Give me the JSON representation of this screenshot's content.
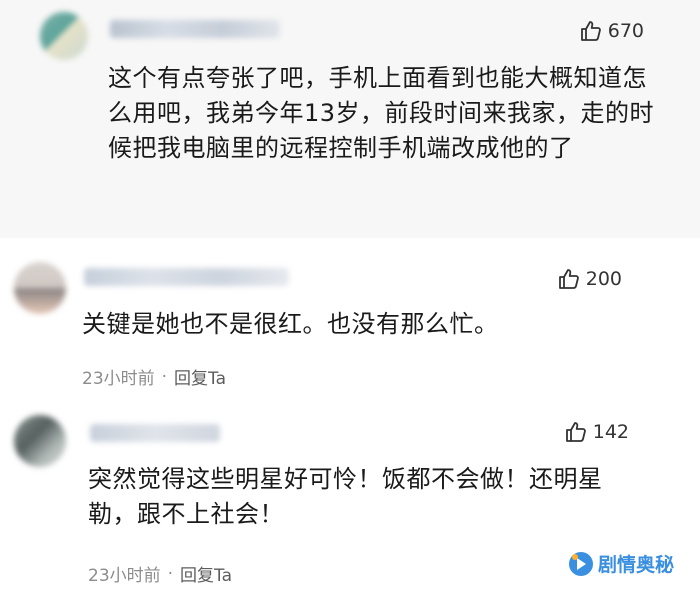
{
  "comments": [
    {
      "likes": "670",
      "text": "这个有点夸张了吧，手机上面看到也能大概知道怎么用吧，我弟今年13岁，前段时间来我家，走的时候把我电脑里的远程控制手机端改成他的了"
    },
    {
      "likes": "200",
      "text": "关键是她也不是很红。也没有那么忙。",
      "time": "23小时前",
      "separator": "·",
      "reply": "回复Ta"
    },
    {
      "likes": "142",
      "text": "突然觉得这些明星好可怜！饭都不会做！还明星勒，跟不上社会！",
      "time": "23小时前",
      "separator": "·",
      "reply": "回复Ta"
    }
  ],
  "watermark": {
    "text": "剧情奥秘",
    "icon": "logo-icon"
  },
  "icons": {
    "like": "thumbs-up-icon"
  },
  "colors": {
    "accent": "#3a8fe0",
    "highlight_bg": "#f7f7f7",
    "meta": "#8c8c8c"
  }
}
